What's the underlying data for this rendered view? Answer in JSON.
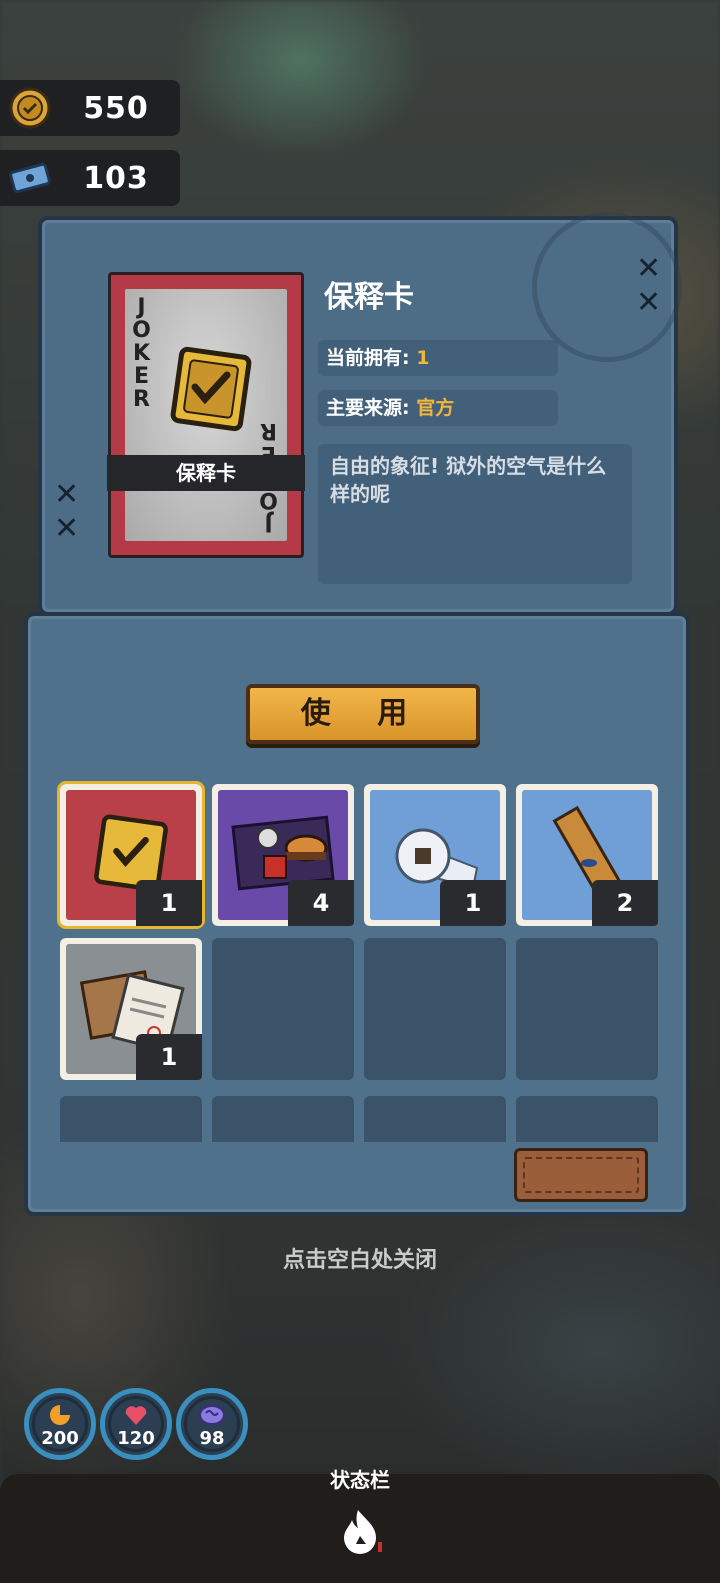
{
  "currencies": [
    {
      "icon": "gold-coin-icon",
      "value": "550"
    },
    {
      "icon": "blue-ticket-icon",
      "value": "103"
    }
  ],
  "detail": {
    "card_name": "保释卡",
    "card_corner_top": "JOKER",
    "card_corner_bottom": "JOKER",
    "title": "保释卡",
    "owned_label": "当前拥有:",
    "owned_value": "1",
    "source_label": "主要来源:",
    "source_value": "官方",
    "description": "自由的象征! 狱外的空气是什么样的呢"
  },
  "use_button": "使 用",
  "inventory": [
    {
      "name": "bail-card",
      "icon": "gold-shield-check-icon",
      "color": "#b94048",
      "count": "1",
      "selected": true
    },
    {
      "name": "fast-food",
      "icon": "burger-meal-icon",
      "color": "#6a4aa8",
      "count": "4",
      "selected": false
    },
    {
      "name": "toilet-paper",
      "icon": "toilet-paper-icon",
      "color": "#6f9fd6",
      "count": "1",
      "selected": false
    },
    {
      "name": "snack-bar",
      "icon": "snack-wrapper-icon",
      "color": "#6f9fd6",
      "count": "2",
      "selected": false
    },
    {
      "name": "document-envelope",
      "icon": "envelope-document-icon",
      "color": "#8a8f94",
      "count": "1",
      "selected": false
    }
  ],
  "close_hint": "点击空白处关闭",
  "stats": [
    {
      "icon": "hunger-icon",
      "value": "200",
      "color": "#f0a02a"
    },
    {
      "icon": "heart-icon",
      "value": "120",
      "color": "#e8506a"
    },
    {
      "icon": "brain-icon",
      "value": "98",
      "color": "#8a7be0"
    }
  ],
  "status_bar_title": "状态栏",
  "status_bar_icon": "flame-icon"
}
